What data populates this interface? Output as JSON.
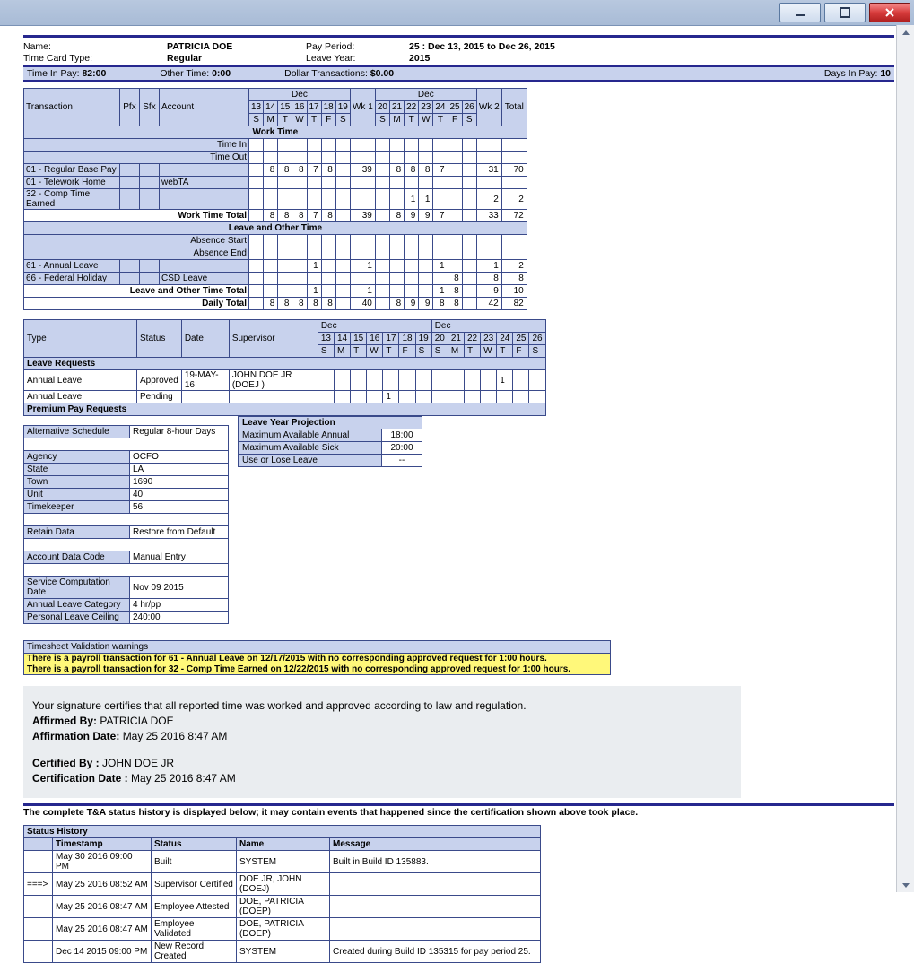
{
  "header": {
    "name_label": "Name:",
    "name": "PATRICIA DOE",
    "tctype_label": "Time Card Type:",
    "tctype": "Regular",
    "payperiod_label": "Pay Period:",
    "payperiod": "25 : Dec 13, 2015 to Dec 26, 2015",
    "leaveyear_label": "Leave Year:",
    "leaveyear": "2015"
  },
  "strip": {
    "tip_label": "Time In Pay: ",
    "tip": "82:00",
    "ot_label": "Other Time: ",
    "ot": "0:00",
    "dt_label": "Dollar Transactions: ",
    "dt": "$0.00",
    "dip_label": "Days In Pay: ",
    "dip": "10"
  },
  "tc": {
    "month": "Dec",
    "days1": [
      "13",
      "14",
      "15",
      "16",
      "17",
      "18",
      "19"
    ],
    "days2": [
      "20",
      "21",
      "22",
      "23",
      "24",
      "25",
      "26"
    ],
    "dows": [
      "S",
      "M",
      "T",
      "W",
      "T",
      "F",
      "S"
    ],
    "col_txn": "Transaction",
    "col_pfx": "Pfx",
    "col_sfx": "Sfx",
    "col_acct": "Account",
    "wk1": "Wk 1",
    "wk2": "Wk 2",
    "total": "Total",
    "work_section": "Work Time",
    "time_in": "Time In",
    "time_out": "Time Out",
    "rows": [
      {
        "label": "01 - Regular Base Pay",
        "d1": [
          "",
          "8",
          "8",
          "8",
          "7",
          "8",
          ""
        ],
        "wk1": "39",
        "d2": [
          "",
          "8",
          "8",
          "8",
          "7",
          "",
          ""
        ],
        "wk2": "31",
        "tot": "70"
      },
      {
        "label": "01 - Telework Home",
        "acct": "webTA"
      },
      {
        "label": "32 - Comp Time Earned",
        "d1": [
          "",
          "",
          "",
          "",
          "",
          "",
          ""
        ],
        "wk1": "",
        "d2": [
          "",
          "",
          "1",
          "1",
          "",
          "",
          ""
        ],
        "wk2": "2",
        "tot": "2"
      }
    ],
    "wt_total_label": "Work Time Total",
    "wt_total": {
      "d1": [
        "",
        "8",
        "8",
        "8",
        "7",
        "8",
        ""
      ],
      "wk1": "39",
      "d2": [
        "",
        "8",
        "9",
        "9",
        "7",
        "",
        ""
      ],
      "wk2": "33",
      "tot": "72"
    },
    "leave_section": "Leave and Other Time",
    "abs_start": "Absence Start",
    "abs_end": "Absence End",
    "lrows": [
      {
        "label": "61 - Annual Leave",
        "d1": [
          "",
          "",
          "",
          "",
          "1",
          "",
          ""
        ],
        "wk1": "1",
        "d2": [
          "",
          "",
          "",
          "",
          "1",
          "",
          ""
        ],
        "wk2": "1",
        "tot": "2"
      },
      {
        "label": "66 - Federal Holiday",
        "acct": "CSD Leave",
        "d1": [
          "",
          "",
          "",
          "",
          "",
          "",
          ""
        ],
        "wk1": "",
        "d2": [
          "",
          "",
          "",
          "",
          "",
          "8",
          ""
        ],
        "wk2": "8",
        "tot": "8"
      }
    ],
    "lt_total_label": "Leave and Other Time Total",
    "lt_total": {
      "d1": [
        "",
        "",
        "",
        "",
        "1",
        "",
        ""
      ],
      "wk1": "1",
      "d2": [
        "",
        "",
        "",
        "",
        "1",
        "8",
        ""
      ],
      "wk2": "9",
      "tot": "10"
    },
    "daily_label": "Daily Total",
    "daily": {
      "d1": [
        "",
        "8",
        "8",
        "8",
        "8",
        "8",
        ""
      ],
      "wk1": "40",
      "d2": [
        "",
        "8",
        "9",
        "9",
        "8",
        "8",
        ""
      ],
      "wk2": "42",
      "tot": "82"
    }
  },
  "req": {
    "month": "Dec",
    "days": [
      "13",
      "14",
      "15",
      "16",
      "17",
      "18",
      "19",
      "20",
      "21",
      "22",
      "23",
      "24",
      "25",
      "26"
    ],
    "dows": [
      "S",
      "M",
      "T",
      "W",
      "T",
      "F",
      "S",
      "S",
      "M",
      "T",
      "W",
      "T",
      "F",
      "S"
    ],
    "col_type": "Type",
    "col_status": "Status",
    "col_date": "Date",
    "col_sup": "Supervisor",
    "leave_section": "Leave Requests",
    "rows": [
      {
        "type": "Annual Leave",
        "status": "Approved",
        "date": "19-MAY-16",
        "sup": "JOHN DOE JR (DOEJ )",
        "marks": {
          "11": "1"
        }
      },
      {
        "type": "Annual Leave",
        "status": "Pending",
        "date": "",
        "sup": "",
        "marks": {
          "4": "1"
        }
      }
    ],
    "premium_section": "Premium Pay Requests"
  },
  "attr": [
    {
      "k": "Alternative Schedule",
      "v": "Regular 8-hour Days"
    },
    {
      "k": "Agency",
      "v": "OCFO"
    },
    {
      "k": "State",
      "v": "LA"
    },
    {
      "k": "Town",
      "v": "1690"
    },
    {
      "k": "Unit",
      "v": "40"
    },
    {
      "k": "Timekeeper",
      "v": "56"
    },
    {
      "k": "Retain Data",
      "v": "Restore from Default"
    },
    {
      "k": "Account Data Code",
      "v": "Manual Entry"
    },
    {
      "k": "Service Computation Date",
      "v": "Nov 09 2015"
    },
    {
      "k": "Annual Leave Category",
      "v": "4 hr/pp"
    },
    {
      "k": "Personal Leave Ceiling",
      "v": "240:00"
    }
  ],
  "attr_spacers": [
    1,
    6,
    7,
    8
  ],
  "proj": {
    "title": "Leave Year Projection",
    "rows": [
      {
        "k": "Maximum Available Annual",
        "v": "18:00"
      },
      {
        "k": "Maximum Available Sick",
        "v": "20:00"
      },
      {
        "k": "Use or Lose Leave",
        "v": "--"
      }
    ]
  },
  "warn": {
    "title": "Timesheet Validation warnings",
    "lines": [
      "There is a payroll transaction for 61 - Annual Leave on 12/17/2015 with no corresponding approved request for 1:00 hours.",
      "There is a payroll transaction for 32 - Comp Time Earned on 12/22/2015 with no corresponding approved request for 1:00 hours."
    ]
  },
  "cert": {
    "intro": "Your signature certifies that all reported time was worked and approved according to law and regulation.",
    "aff_by_label": "Affirmed By:",
    "aff_by": "PATRICIA DOE",
    "aff_date_label": "Affirmation Date:",
    "aff_date": "May 25 2016 8:47 AM",
    "cert_by_label": "Certified By :",
    "cert_by": "JOHN DOE JR",
    "cert_date_label": "Certification Date :",
    "cert_date": "May 25 2016 8:47 AM"
  },
  "histnote": "The complete T&A status history is displayed below; it may contain events that happened since the certification shown above took place.",
  "sh": {
    "title": "Status History",
    "cols": {
      "ts": "Timestamp",
      "status": "Status",
      "name": "Name",
      "msg": "Message"
    },
    "rows": [
      {
        "arrow": "",
        "ts": "May 30 2016 09:00 PM",
        "status": "Built",
        "name": "SYSTEM",
        "msg": "Built in Build ID 135883."
      },
      {
        "arrow": "===>",
        "ts": "May 25 2016 08:52 AM",
        "status": "Supervisor Certified",
        "name": "DOE JR, JOHN (DOEJ)",
        "msg": ""
      },
      {
        "arrow": "",
        "ts": "May 25 2016 08:47 AM",
        "status": "Employee Attested",
        "name": "DOE, PATRICIA (DOEP)",
        "msg": ""
      },
      {
        "arrow": "",
        "ts": "May 25 2016 08:47 AM",
        "status": "Employee Validated",
        "name": "DOE, PATRICIA (DOEP)",
        "msg": ""
      },
      {
        "arrow": "",
        "ts": "Dec 14 2015 09:00 PM",
        "status": "New Record Created",
        "name": "SYSTEM",
        "msg": "Created during Build ID 135315 for pay period 25."
      }
    ]
  }
}
